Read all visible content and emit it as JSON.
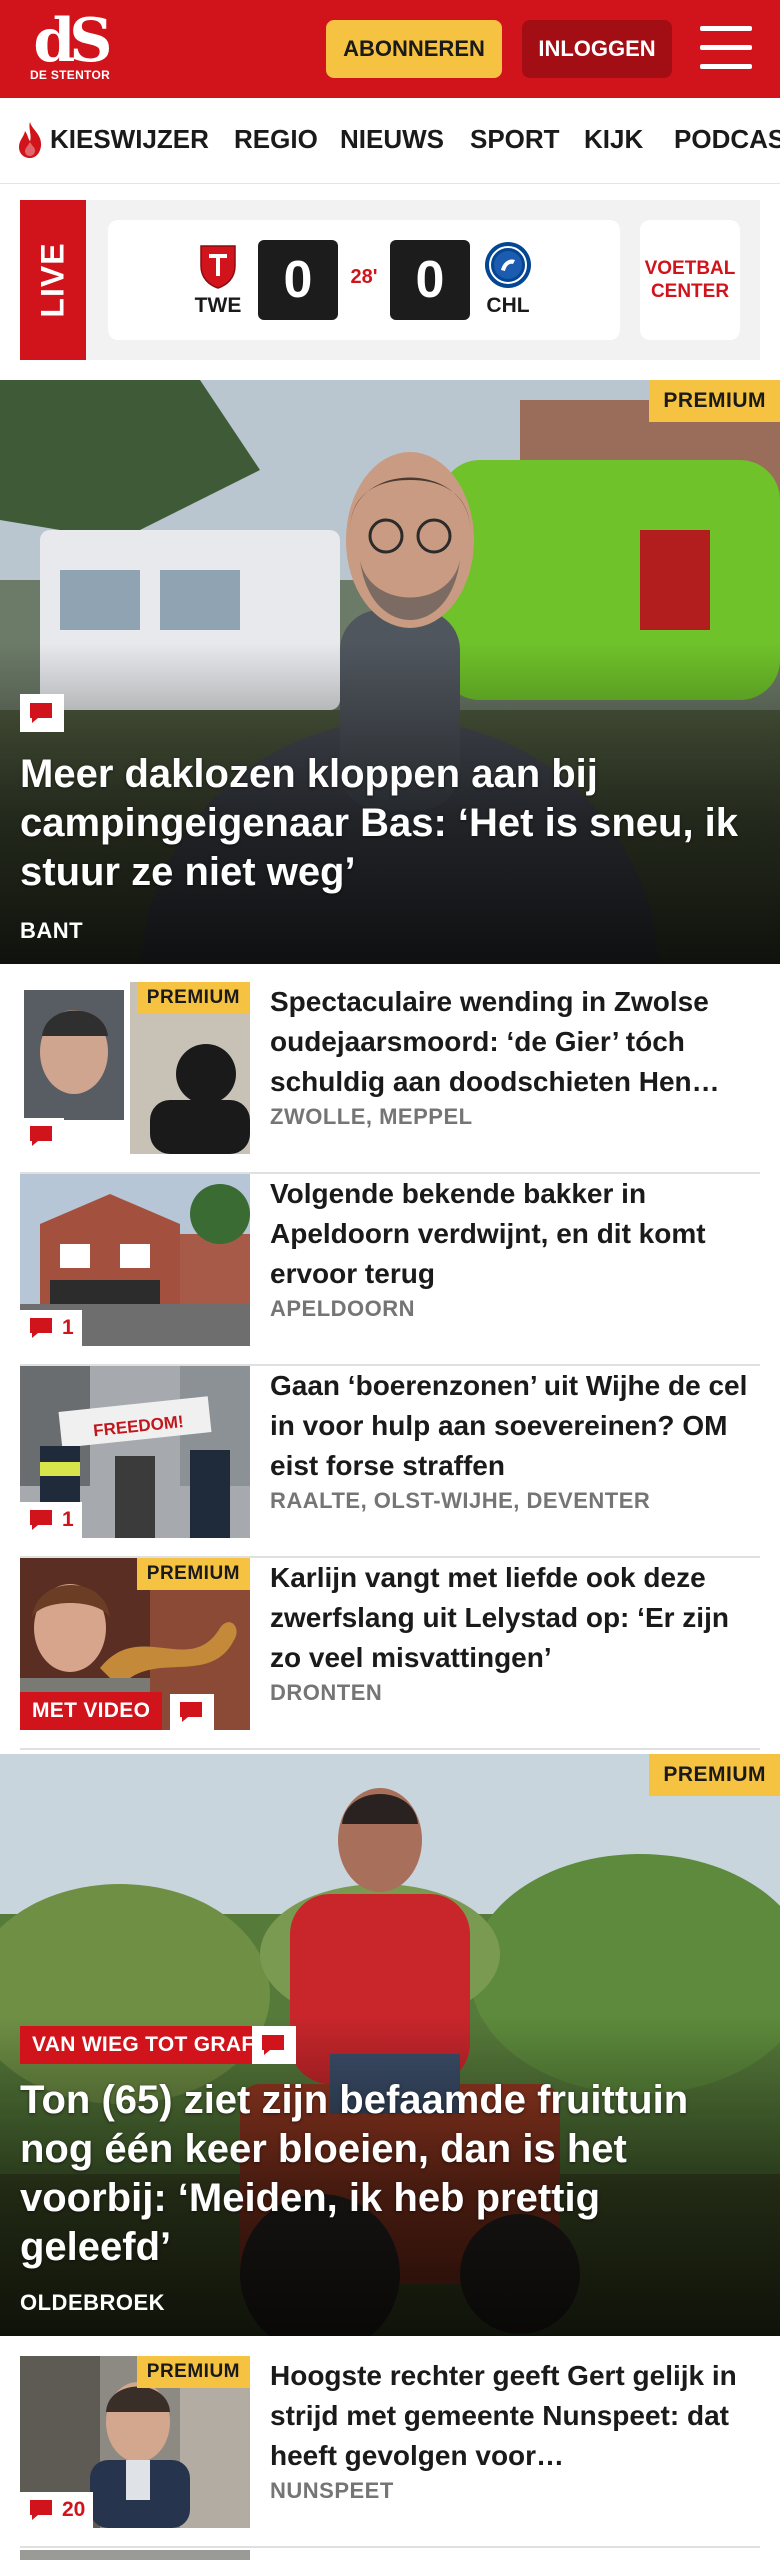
{
  "header": {
    "logo_mark": "dS",
    "logo_sub": "DE STENTOR",
    "subscribe_label": "ABONNEREN",
    "login_label": "INLOGGEN",
    "brand_color": "#d1131b",
    "accent_color": "#f5c242"
  },
  "nav": {
    "items": [
      "KIESWIJZER",
      "REGIO",
      "NIEUWS",
      "SPORT",
      "KIJK",
      "PODCAS"
    ]
  },
  "live": {
    "label": "LIVE",
    "home_team": "TWE",
    "away_team": "CHL",
    "home_score": "0",
    "away_score": "0",
    "minute": "28'",
    "center_label": "VOETBAL CENTER"
  },
  "hero1": {
    "premium": "PREMIUM",
    "title": "Meer daklozen kloppen aan bij campingeigenaar Bas: ‘Het is sneu, ik stuur ze niet weg’",
    "location": "BANT"
  },
  "articles": [
    {
      "premium": "PREMIUM",
      "title": "Spectaculaire wending in Zwolse oudejaarsmoord: ‘de Gier’ tóch schuldig aan doodschieten Hen…",
      "location": "ZWOLLE, MEPPEL",
      "comments": ""
    },
    {
      "premium": "",
      "title": "Volgende bekende bakker in Apeldoorn verdwijnt, en dit komt ervoor terug",
      "location": "APELDOORN",
      "comments": "1"
    },
    {
      "premium": "",
      "title": "Gaan ‘boerenzonen’ uit Wijhe de cel in voor hulp aan soevereinen? OM eist forse straffen",
      "location": "RAALTE, OLST-WIJHE, DEVENTER",
      "comments": "1",
      "banner_text": "FREEDOM!"
    },
    {
      "premium": "PREMIUM",
      "title": "Karlijn vangt met liefde ook deze zwerfslang uit Lelystad op: ‘Er zijn zo veel misvattingen’",
      "location": "DRONTEN",
      "comments": "",
      "video_label": "MET VIDEO"
    }
  ],
  "hero2": {
    "premium": "PREMIUM",
    "tag": "VAN WIEG TOT GRAF",
    "title": "Ton (65) ziet zijn befaamde fruittuin nog één keer bloeien, dan is het voorbij: ‘Meiden, ik heb prettig geleefd’",
    "location": "OLDEBROEK"
  },
  "article5": {
    "premium": "PREMIUM",
    "title": "Hoogste rechter geeft Gert gelijk in strijd met gemeente Nunspeet: dat heeft gevolgen voor…",
    "location": "NUNSPEET",
    "comments": "20"
  }
}
